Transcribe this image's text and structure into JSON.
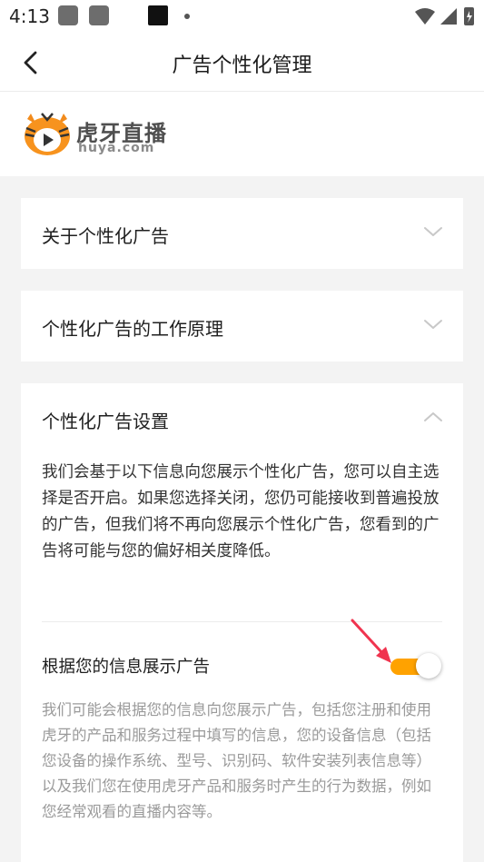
{
  "status_bar": {
    "time": "4:13"
  },
  "header": {
    "title": "广告个性化管理"
  },
  "brand": {
    "name_cn": "虎牙直播",
    "name_en": "huya.com"
  },
  "sections": [
    {
      "title": "关于个性化广告",
      "expanded": false
    },
    {
      "title": "个性化广告的工作原理",
      "expanded": false
    },
    {
      "title": "个性化广告设置",
      "expanded": true,
      "description": "我们会基于以下信息向您展示个性化广告，您可以自主选择是否开启。如果您选择关闭，您仍可能接收到普遍投放的广告，但我们将不再向您展示个性化广告，您看到的广告将可能与您的偏好相关度降低。",
      "toggle": {
        "label": "根据您的信息展示广告",
        "on": true,
        "description": "我们可能会根据您的信息向您展示广告，包括您注册和使用虎牙的产品和服务过程中填写的信息，您的设备信息（包括您设备的操作系统、型号、识别码、软件安装列表信息等）以及我们您在使用虎牙产品和服务时产生的行为数据，例如您经常观看的直播内容等。"
      }
    }
  ],
  "colors": {
    "accent": "#ffa200",
    "annotation_arrow": "#f0344f"
  }
}
